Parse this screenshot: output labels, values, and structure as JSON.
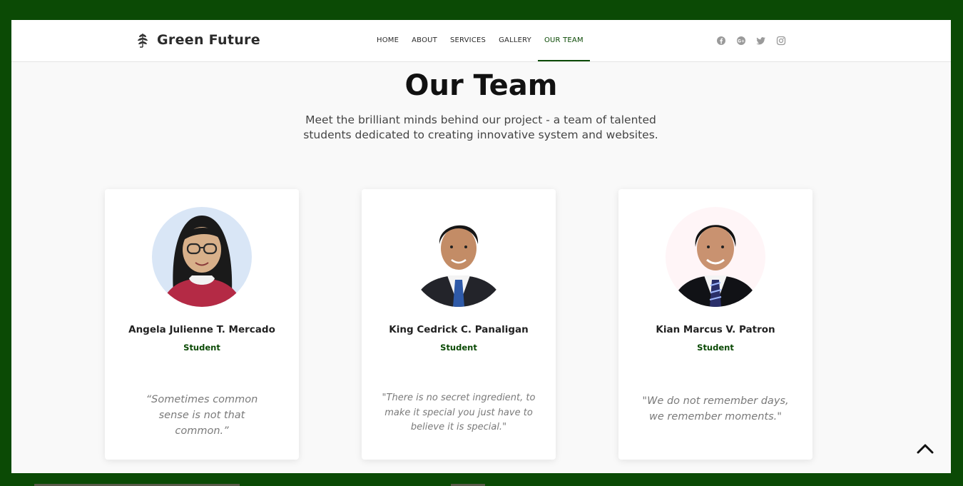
{
  "brand": {
    "name": "Green Future",
    "icon": "leaf-icon"
  },
  "nav": {
    "items": [
      {
        "label": "HOME",
        "active": false
      },
      {
        "label": "ABOUT",
        "active": false
      },
      {
        "label": "SERVICES",
        "active": false
      },
      {
        "label": "GALLERY",
        "active": false
      },
      {
        "label": "OUR TEAM",
        "active": true
      }
    ]
  },
  "social": [
    "facebook-icon",
    "google-plus-icon",
    "twitter-icon",
    "instagram-icon"
  ],
  "section": {
    "title": "Our Team",
    "subtitle": "Meet the brilliant minds behind our project - a team of talented students dedicated to creating innovative system and websites."
  },
  "team": [
    {
      "name": "Angela Julienne T. Mercado",
      "role": "Student",
      "quote": "“Sometimes common sense is not that common.”"
    },
    {
      "name": "King Cedrick C. Panaligan",
      "role": "Student",
      "quote": "\"There is no secret ingredient, to make it special you just have to believe it is special.\""
    },
    {
      "name": "Kian Marcus V. Patron",
      "role": "Student",
      "quote": "\"We do not remember days, we remember moments.\""
    }
  ],
  "colors": {
    "accent": "#0b4a05",
    "page_bg": "#f9f9f9",
    "frame": "#0b4a05"
  }
}
